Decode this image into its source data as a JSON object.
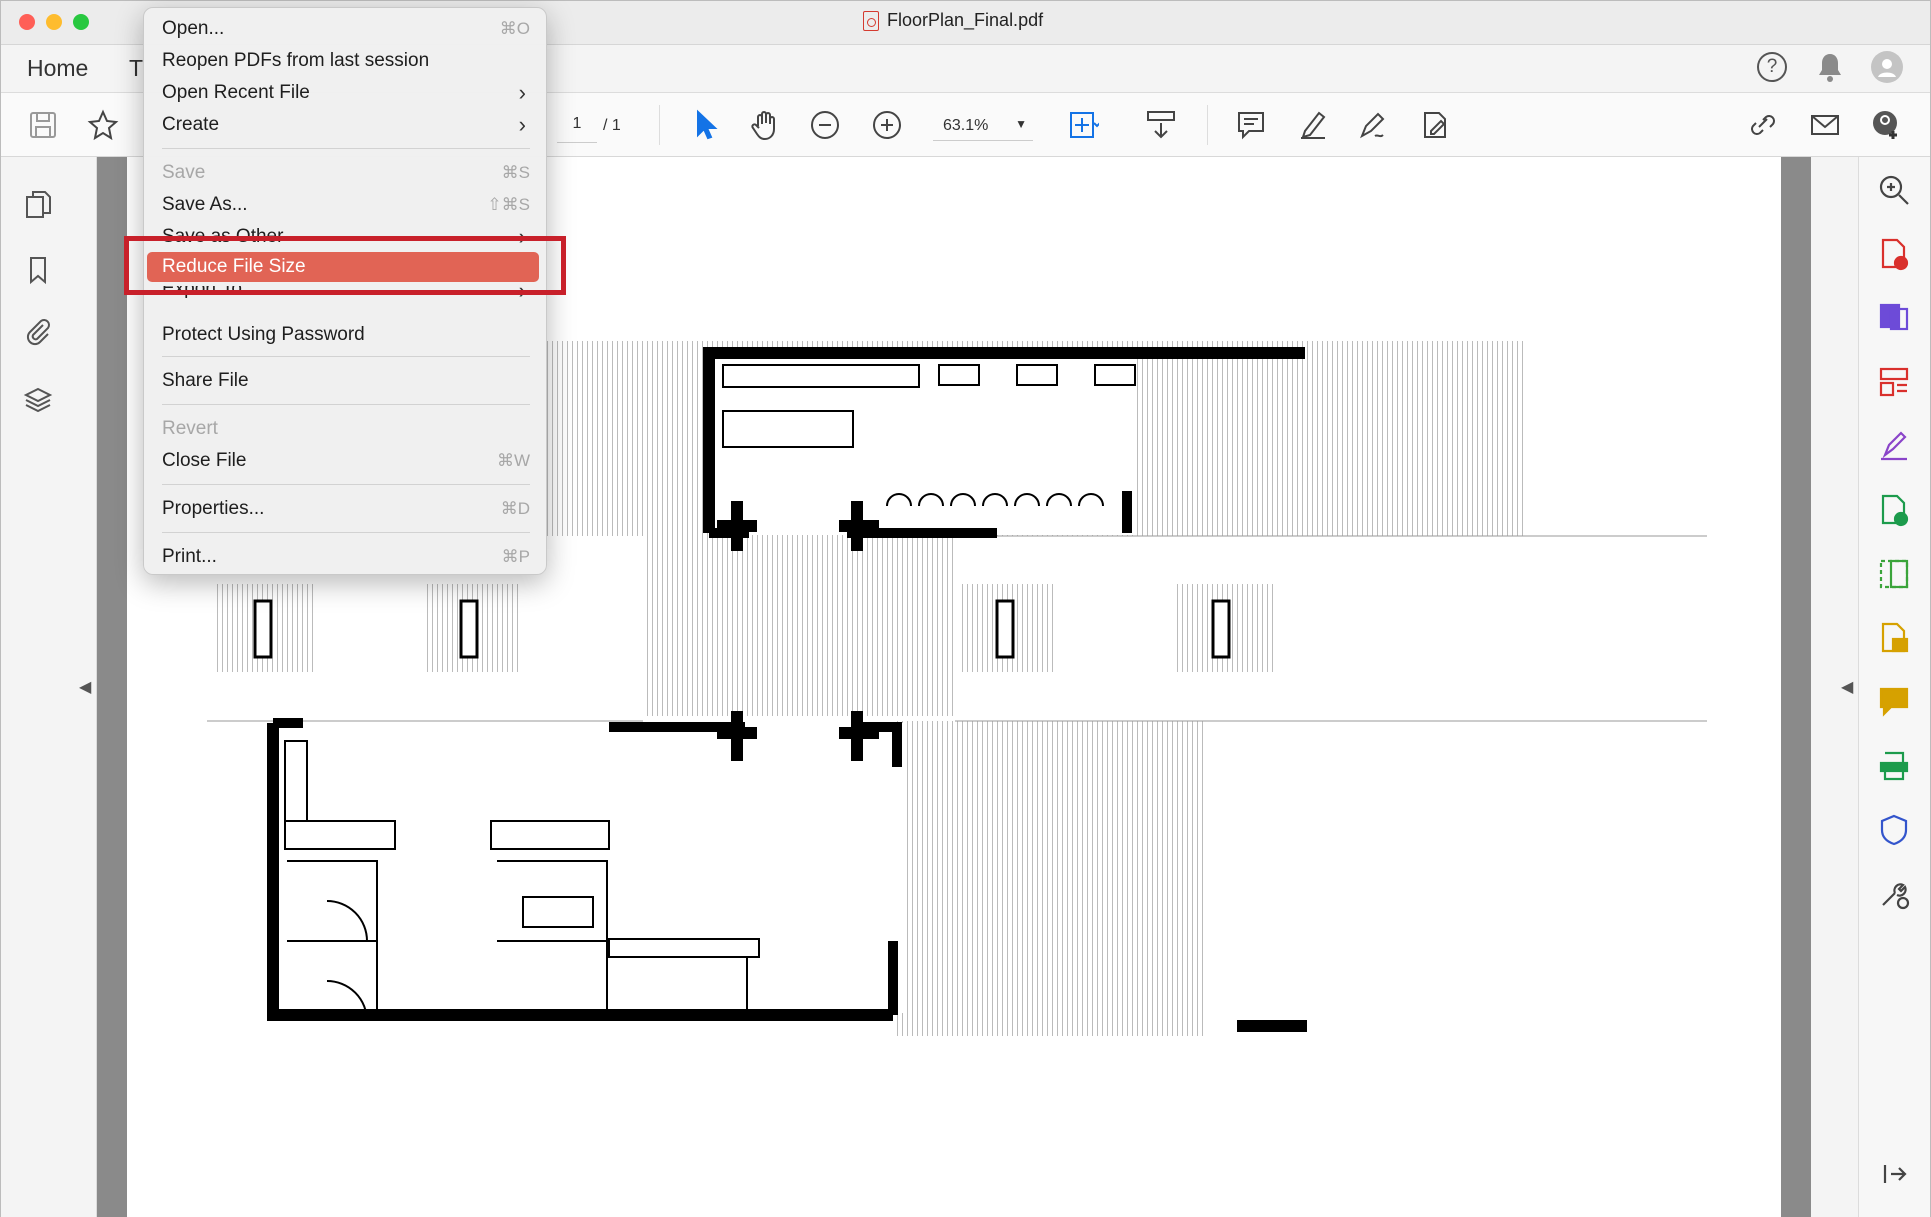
{
  "window": {
    "title": "FloorPlan_Final.pdf"
  },
  "tabs": {
    "home": "Home",
    "tools_partial": "T"
  },
  "toolbar": {
    "page_current": "1",
    "page_total": "/ 1",
    "zoom": "63.1%"
  },
  "menu": {
    "open": {
      "label": "Open...",
      "shortcut": "⌘O"
    },
    "reopen": {
      "label": "Reopen PDFs from last session"
    },
    "open_recent": {
      "label": "Open Recent File",
      "arrow": "›"
    },
    "create": {
      "label": "Create",
      "arrow": "›"
    },
    "save": {
      "label": "Save",
      "shortcut": "⌘S"
    },
    "save_as": {
      "label": "Save As...",
      "shortcut": "⇧⌘S"
    },
    "save_other": {
      "label": "Save as Other",
      "arrow": "›"
    },
    "reduce": {
      "label": "Reduce File Size"
    },
    "export": {
      "label": "Export To",
      "arrow": "›"
    },
    "protect": {
      "label": "Protect Using Password"
    },
    "share": {
      "label": "Share File"
    },
    "revert": {
      "label": "Revert"
    },
    "close": {
      "label": "Close File",
      "shortcut": "⌘W"
    },
    "properties": {
      "label": "Properties...",
      "shortcut": "⌘D"
    },
    "print": {
      "label": "Print...",
      "shortcut": "⌘P"
    }
  },
  "colors": {
    "highlight": "#e16455",
    "callout": "#c8202a",
    "accent": "#1473e6"
  }
}
